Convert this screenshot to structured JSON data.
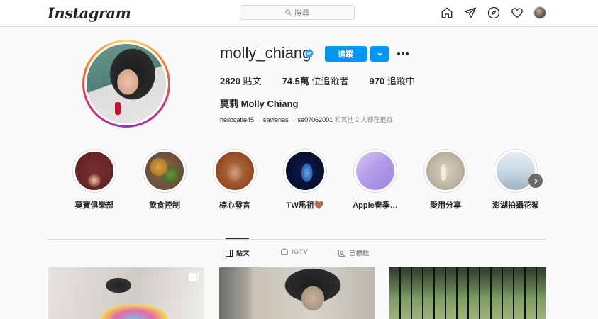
{
  "nav": {
    "logo": "Instagram",
    "search_placeholder": "搜尋",
    "icons": [
      "home-icon",
      "direct-icon",
      "explore-icon",
      "activity-heart-icon",
      "profile-avatar"
    ]
  },
  "profile": {
    "username": "molly_chiang",
    "verified": true,
    "follow_label": "追蹤",
    "stats": {
      "posts_count": "2820",
      "posts_label": "貼文",
      "followers_count": "74.5萬",
      "followers_label": "位追蹤者",
      "following_count": "970",
      "following_label": "追蹤中"
    },
    "full_name": "莫莉 Molly Chiang",
    "followed_by": {
      "users": [
        "hellocatie45",
        "savienas",
        "sa07062001"
      ],
      "suffix": "和其他 2 人都在追蹤"
    }
  },
  "highlights": [
    {
      "label": "莫寶俱樂部"
    },
    {
      "label": "飲食控制"
    },
    {
      "label": "棕心發言"
    },
    {
      "label": "TW馬祖🤎"
    },
    {
      "label": "Apple春季…"
    },
    {
      "label": "愛用分享"
    },
    {
      "label": "澎湖拍攝花絮"
    }
  ],
  "tabs": [
    {
      "label": "貼文",
      "active": true
    },
    {
      "label": "IGTV",
      "active": false
    },
    {
      "label": "已標註",
      "active": false
    }
  ],
  "colors": {
    "accent": "#0095f6",
    "text": "#262626",
    "muted": "#8e8e8e",
    "border": "#dbdbdb"
  }
}
